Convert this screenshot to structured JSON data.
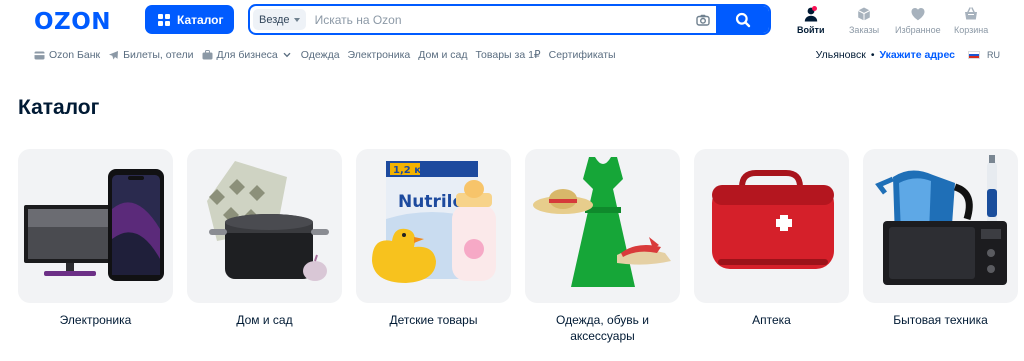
{
  "header": {
    "logo": "OZON",
    "catalog_label": "Каталог",
    "search": {
      "scope": "Везде",
      "placeholder": "Искать на Ozon",
      "value": ""
    },
    "actions": [
      {
        "label": "Войти",
        "icon": "user-icon"
      },
      {
        "label": "Заказы",
        "icon": "box-icon"
      },
      {
        "label": "Избранное",
        "icon": "heart-icon"
      },
      {
        "label": "Корзина",
        "icon": "cart-icon"
      }
    ]
  },
  "subnav": {
    "items": [
      {
        "label": "Ozon Банк",
        "icon": "card-icon"
      },
      {
        "label": "Билеты, отели",
        "icon": "plane-icon"
      },
      {
        "label": "Для бизнеса",
        "icon": "briefcase-icon",
        "dropdown": true
      },
      {
        "label": "Одежда"
      },
      {
        "label": "Электроника"
      },
      {
        "label": "Дом и сад"
      },
      {
        "label": "Товары за 1₽"
      },
      {
        "label": "Сертификаты"
      }
    ],
    "location": {
      "city": "Ульяновск",
      "separator": "•",
      "action": "Укажите адрес",
      "lang": "RU"
    }
  },
  "page": {
    "title": "Каталог"
  },
  "categories": [
    {
      "label": "Электроника",
      "image": "tv-and-phone"
    },
    {
      "label": "Дом и сад",
      "image": "pillow-and-pot"
    },
    {
      "label": "Детские товары",
      "image": "duck-formula-bottle",
      "box_text": "1,2 кг",
      "brand_text": "Nutrilon"
    },
    {
      "label": "Одежда, обувь и аксессуары",
      "image": "dress-hat-shoes"
    },
    {
      "label": "Аптека",
      "image": "first-aid-kit"
    },
    {
      "label": "Бытовая техника",
      "image": "kettle-microwave-toothbrush"
    }
  ],
  "colors": {
    "brand": "#005bff",
    "text": "#001a34",
    "muted": "#8c99a6",
    "tile_bg": "#f2f3f5",
    "badge": "#f91155"
  }
}
